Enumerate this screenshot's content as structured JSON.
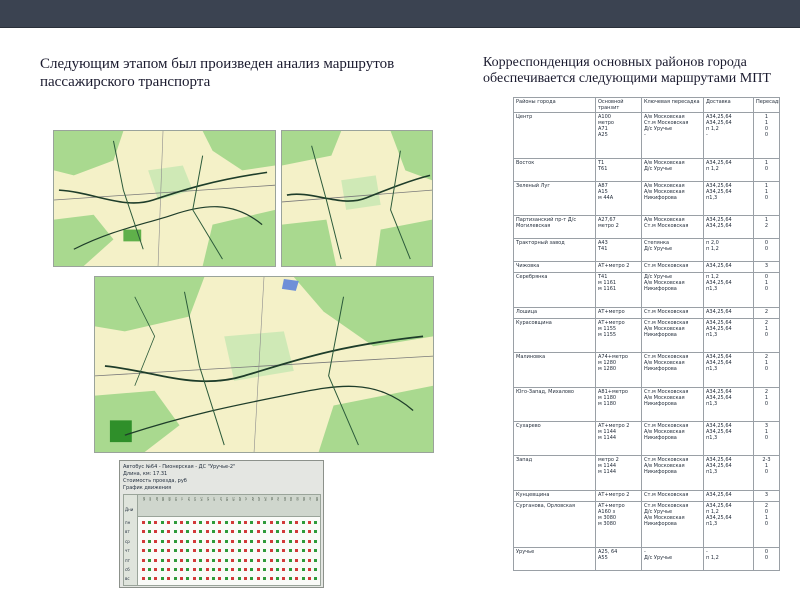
{
  "heading_left": "Следующим этапом был произведен анализ маршрутов пассажирского транспорта",
  "heading_right": "Корреспонденция основных районов города обеспечивается следующими маршрутами МПТ",
  "colors": {
    "top_bar": "#3b4351",
    "map_land": "#f4f1c8",
    "map_green": "#a9d98f",
    "map_dark_green": "#5fb04a",
    "map_route": "#1e3d2a",
    "map_water": "#6f8fd8",
    "schedule_dot": "#2e9b3a",
    "schedule_cross": "#d23a3a"
  },
  "schedule": {
    "title": "Автобус №64 - Пионерская - ДС \"Уручье-2\"",
    "length": "Длина, км: 17.31",
    "fare": "Стоимость проезда, руб",
    "interval": "График движения",
    "day_header": "Дни",
    "days": [
      "пн",
      "вт",
      "ср",
      "чт",
      "пт",
      "сб",
      "вс"
    ],
    "hours": [
      "05",
      "06",
      "07",
      "08",
      "09",
      "10",
      "11",
      "12",
      "13",
      "14",
      "15",
      "16",
      "17",
      "18",
      "19",
      "20",
      "21",
      "22",
      "23",
      "24",
      "01",
      "02",
      "03",
      "04",
      "05",
      "06",
      "07",
      "08"
    ]
  },
  "table": {
    "headers": [
      "Районы города",
      "Основной транзит",
      "Ключевая пересадка",
      "Доставка",
      "Пересадки"
    ],
    "rows": [
      {
        "name": "Центр",
        "lines": 4,
        "transit": [
          "А100",
          "метро",
          "А71",
          "А25"
        ],
        "transfer": [
          "А/в Московская",
          "Ст.м Московская",
          "Д/с Уручье",
          "-"
        ],
        "delivery": [
          "А34,25,64",
          "А34,25,64",
          "п 1,2",
          "-"
        ],
        "changes": [
          "1",
          "1",
          "0",
          "0"
        ]
      },
      {
        "name": "Восток",
        "lines": 2,
        "transit": [
          "Т1",
          "Т61"
        ],
        "transfer": [
          "А/в Московская",
          "Д/с Уручье"
        ],
        "delivery": [
          "А34,25,64",
          "п 1,2"
        ],
        "changes": [
          "1",
          "0"
        ]
      },
      {
        "name": "Зеленый Луг",
        "lines": 3,
        "transit": [
          "А87",
          "А15",
          "м 44А"
        ],
        "transfer": [
          "А/в Московская",
          "А/в Московская",
          "Никифорова"
        ],
        "delivery": [
          "А34,25,64",
          "А34,25,64",
          "п1,3"
        ],
        "changes": [
          "1",
          "1",
          "0"
        ]
      },
      {
        "name": "Партизанский пр-т Д/с Могилевская",
        "lines": 2,
        "transit": [
          "А27,67",
          "метро 2"
        ],
        "transfer": [
          "А/в Московская",
          "Ст.м Московская"
        ],
        "delivery": [
          "А34,25,64",
          "А34,25,64"
        ],
        "changes": [
          "1",
          "2"
        ]
      },
      {
        "name": "Тракторный завод",
        "lines": 2,
        "transit": [
          "А43",
          "Т41"
        ],
        "transfer": [
          "Степянка",
          "Д/с Уручье"
        ],
        "delivery": [
          "п 2,0",
          "п 1,2"
        ],
        "changes": [
          "0",
          "0"
        ]
      },
      {
        "name": "Чижовка",
        "lines": 1,
        "transit": [
          "АТ+метро 2"
        ],
        "transfer": [
          "Ст.м Московская"
        ],
        "delivery": [
          "А34,25,64"
        ],
        "changes": [
          "3"
        ]
      },
      {
        "name": "Серебрянка",
        "lines": 3,
        "transit": [
          "Т41",
          "м 1161",
          "м 1161"
        ],
        "transfer": [
          "Д/с Уручье",
          "А/в Московская",
          "Никифорова"
        ],
        "delivery": [
          "п 1,2",
          "А34,25,64",
          "п1,3"
        ],
        "changes": [
          "0",
          "1",
          "0"
        ]
      },
      {
        "name": "Лошица",
        "lines": 1,
        "transit": [
          "АТ+метро"
        ],
        "transfer": [
          "Ст.м Московская"
        ],
        "delivery": [
          "А34,25,64"
        ],
        "changes": [
          "2"
        ]
      },
      {
        "name": "Курасовщина",
        "lines": 3,
        "transit": [
          "АТ+метро",
          "м 1155",
          "м 1155"
        ],
        "transfer": [
          "Ст.м Московская",
          "А/в Московская",
          "Никифорова"
        ],
        "delivery": [
          "А34,25,64",
          "А34,25,64",
          "п1,3"
        ],
        "changes": [
          "2",
          "1",
          "0"
        ]
      },
      {
        "name": "Малиновка",
        "lines": 3,
        "transit": [
          "А74+метро",
          "м 1280",
          "м 1280"
        ],
        "transfer": [
          "Ст.м Московская",
          "А/в Московская",
          "Никифорова"
        ],
        "delivery": [
          "А34,25,64",
          "А34,25,64",
          "п1,3"
        ],
        "changes": [
          "2",
          "1",
          "0"
        ]
      },
      {
        "name": "Юго-Запад, Михалово",
        "lines": 3,
        "transit": [
          "А81+метро",
          "м 1180",
          "м 1180"
        ],
        "transfer": [
          "Ст.м Московская",
          "А/в Московская",
          "Никифорова"
        ],
        "delivery": [
          "А34,25,64",
          "А34,25,64",
          "п1,3"
        ],
        "changes": [
          "2",
          "1",
          "0"
        ]
      },
      {
        "name": "Сухарево",
        "lines": 3,
        "transit": [
          "АТ+метро 2",
          "м 1144",
          "м 1144"
        ],
        "transfer": [
          "Ст.м Московская",
          "А/в Московская",
          "Никифорова"
        ],
        "delivery": [
          "А34,25,64",
          "А34,25,64",
          "п1,3"
        ],
        "changes": [
          "3",
          "1",
          "0"
        ]
      },
      {
        "name": "Запад",
        "lines": 3,
        "transit": [
          "метро 2",
          "м 1144",
          "м 1144"
        ],
        "transfer": [
          "Ст.м Московская",
          "А/в Московская",
          "Никифорова"
        ],
        "delivery": [
          "А34,25,64",
          "А34,25,64",
          "п1,3"
        ],
        "changes": [
          "2-3",
          "1",
          "0"
        ]
      },
      {
        "name": "Кунцевщина",
        "lines": 1,
        "transit": [
          "АТ+метро 2"
        ],
        "transfer": [
          "Ст.м Московская"
        ],
        "delivery": [
          "А34,25,64"
        ],
        "changes": [
          "3"
        ]
      },
      {
        "name": "Сурганова, Орловская",
        "lines": 4,
        "transit": [
          "АТ+метро",
          "А160 з",
          "м 3080",
          "м 3080"
        ],
        "transfer": [
          "Ст.м Московская",
          "Д/с Уручье",
          "А/в Московская",
          "Никифорова"
        ],
        "delivery": [
          "А34,25,64",
          "п 1,2",
          "А34,25,64",
          "п1,3"
        ],
        "changes": [
          "2",
          "0",
          "1",
          "0"
        ]
      },
      {
        "name": "Уручье",
        "lines": 2,
        "transit": [
          "А25, 64",
          "А55"
        ],
        "transfer": [
          "-",
          "Д/с Уручье"
        ],
        "delivery": [
          "-",
          "п 1,2"
        ],
        "changes": [
          "0",
          "0"
        ]
      }
    ]
  }
}
